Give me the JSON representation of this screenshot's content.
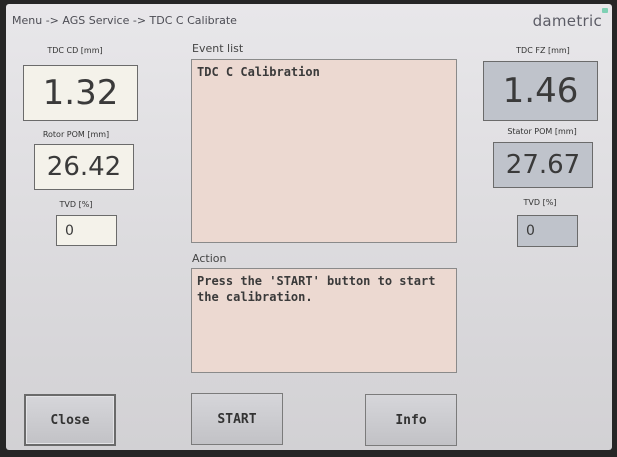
{
  "header": {
    "breadcrumb": "Menu -> AGS Service -> TDC C Calibrate",
    "brand": "dametric"
  },
  "left": {
    "tdc_cd": {
      "label": "TDC CD [mm]",
      "value": "1.32"
    },
    "rotor_pom": {
      "label": "Rotor POM [mm]",
      "value": "26.42"
    },
    "tvd": {
      "label": "TVD [%]",
      "value": "0"
    }
  },
  "right": {
    "tdc_fz": {
      "label": "TDC FZ [mm]",
      "value": "1.46"
    },
    "stator_pom": {
      "label": "Stator POM [mm]",
      "value": "27.67"
    },
    "tvd": {
      "label": "TVD [%]",
      "value": "0"
    }
  },
  "event_list": {
    "label": "Event list",
    "text": "TDC C Calibration"
  },
  "action": {
    "label": "Action",
    "text": "Press the 'START' button to start the calibration."
  },
  "buttons": {
    "close": "Close",
    "start": "START",
    "info": "Info"
  },
  "colors": {
    "panel_bg": "#ecd9d1",
    "value_box_bg": "#f4f2ea",
    "value_box_blue": "#bfc3cb",
    "brand_accent": "#7fd0b4"
  }
}
